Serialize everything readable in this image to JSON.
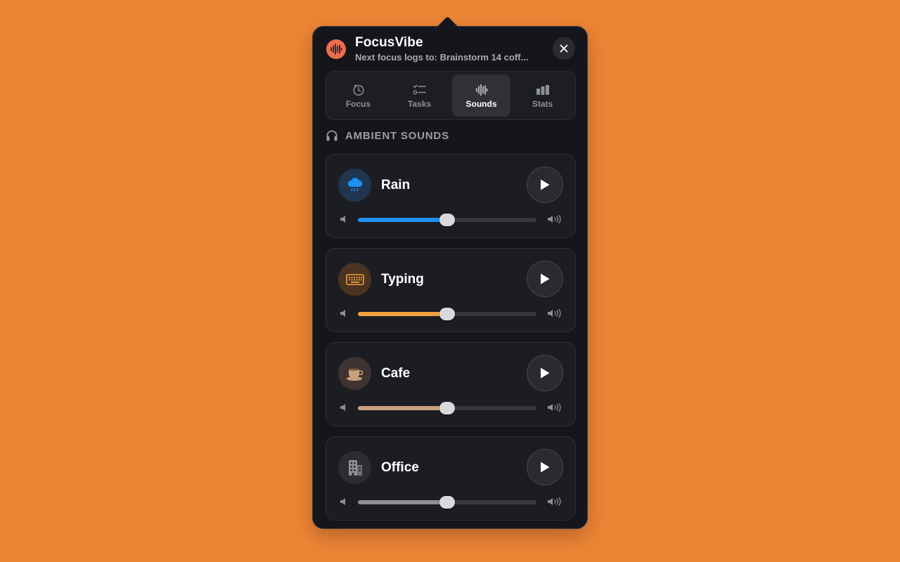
{
  "app": {
    "title": "FocusVibe",
    "subtitle": "Next focus logs to: Brainstorm 14 coff...",
    "icon": "waveform-icon",
    "accent": "#EE6B4E"
  },
  "tabs": [
    {
      "label": "Focus",
      "icon": "timer-icon",
      "active": false
    },
    {
      "label": "Tasks",
      "icon": "checklist-icon",
      "active": false
    },
    {
      "label": "Sounds",
      "icon": "waveform-icon",
      "active": true
    },
    {
      "label": "Stats",
      "icon": "bar-chart-icon",
      "active": false
    }
  ],
  "section": {
    "title": "AMBIENT SOUNDS",
    "icon": "headphones-icon"
  },
  "sounds": [
    {
      "name": "Rain",
      "icon": "cloud-rain-icon",
      "color": "#1E90F0",
      "volume": 0.5,
      "playing": false
    },
    {
      "name": "Typing",
      "icon": "keyboard-icon",
      "color": "#F0A03C",
      "volume": 0.5,
      "playing": false
    },
    {
      "name": "Cafe",
      "icon": "coffee-cup-icon",
      "color": "#C9A07F",
      "volume": 0.5,
      "playing": false
    },
    {
      "name": "Office",
      "icon": "building-icon",
      "color": "#8E8F95",
      "volume": 0.5,
      "playing": false
    }
  ]
}
